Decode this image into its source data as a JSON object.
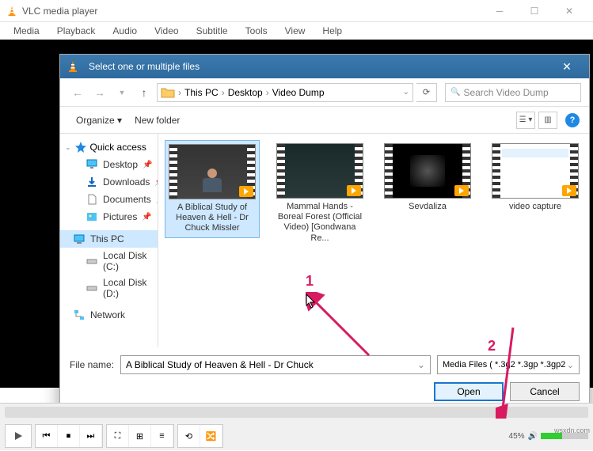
{
  "window": {
    "title": "VLC media player"
  },
  "menubar": [
    "Media",
    "Playback",
    "Audio",
    "Video",
    "Subtitle",
    "Tools",
    "View",
    "Help"
  ],
  "dialog": {
    "title": "Select one or multiple files",
    "breadcrumb": {
      "parts": [
        "This PC",
        "Desktop",
        "Video Dump"
      ]
    },
    "search_placeholder": "Search Video Dump",
    "toolbar": {
      "organize": "Organize",
      "new_folder": "New folder"
    },
    "sidebar": {
      "quick_access": "Quick access",
      "items": [
        {
          "label": "Desktop",
          "icon": "desktop"
        },
        {
          "label": "Downloads",
          "icon": "downloads"
        },
        {
          "label": "Documents",
          "icon": "documents"
        },
        {
          "label": "Pictures",
          "icon": "pictures"
        }
      ],
      "this_pc": "This PC",
      "drives": [
        {
          "label": "Local Disk (C:)"
        },
        {
          "label": "Local Disk (D:)"
        }
      ],
      "network": "Network"
    },
    "files": [
      {
        "label": "A Biblical Study of Heaven & Hell - Dr Chuck Missler",
        "selected": true
      },
      {
        "label": "Mammal Hands - Boreal Forest (Official Video) [Gondwana Re...",
        "selected": false
      },
      {
        "label": "Sevdaliza",
        "selected": false
      },
      {
        "label": "video capture",
        "selected": false
      }
    ],
    "filename_label": "File name:",
    "filename_value": "A Biblical Study of Heaven & Hell - Dr Chuck",
    "filter_value": "Media Files ( *.3g2 *.3gp *.3gp2",
    "open_btn": "Open",
    "cancel_btn": "Cancel"
  },
  "annotations": {
    "num1": "1",
    "num2": "2"
  },
  "player": {
    "volume_pct": "45%"
  },
  "watermark": "wsxdn.com"
}
